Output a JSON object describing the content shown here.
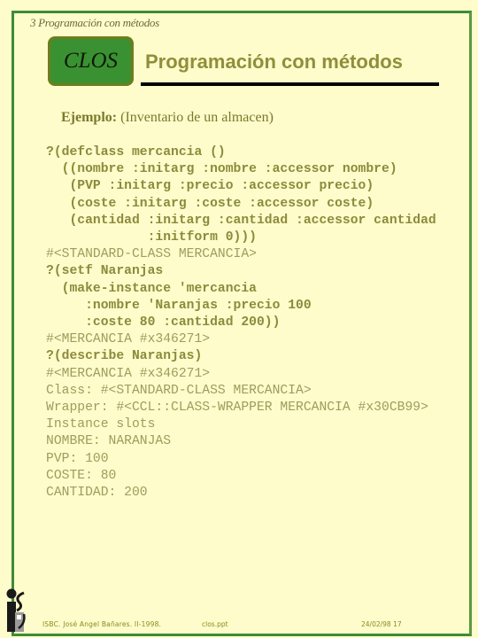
{
  "header": {
    "section_label": "3 Programación con métodos",
    "badge": "CLOS",
    "title": "Programación con métodos"
  },
  "example": {
    "label": "Ejemplo:",
    "description": "(Inventario de un almacen)"
  },
  "code_lines": [
    {
      "text": "?(defclass mercancia ()",
      "kind": "in"
    },
    {
      "text": "  ((nombre :initarg :nombre :accessor nombre)",
      "kind": "in"
    },
    {
      "text": "   (PVP :initarg :precio :accessor precio)",
      "kind": "in"
    },
    {
      "text": "   (coste :initarg :coste :accessor coste)",
      "kind": "in"
    },
    {
      "text": "   (cantidad :initarg :cantidad :accessor cantidad",
      "kind": "in"
    },
    {
      "text": "             :initform 0)))",
      "kind": "in"
    },
    {
      "text": "#<STANDARD-CLASS MERCANCIA>",
      "kind": "out"
    },
    {
      "text": "?(setf Naranjas",
      "kind": "in"
    },
    {
      "text": "  (make-instance 'mercancia",
      "kind": "in"
    },
    {
      "text": "     :nombre 'Naranjas :precio 100",
      "kind": "in"
    },
    {
      "text": "     :coste 80 :cantidad 200))",
      "kind": "in"
    },
    {
      "text": "#<MERCANCIA #x346271>",
      "kind": "out"
    },
    {
      "text": "?(describe Naranjas)",
      "kind": "in"
    },
    {
      "text": "#<MERCANCIA #x346271>",
      "kind": "out"
    },
    {
      "text": "Class: #<STANDARD-CLASS MERCANCIA>",
      "kind": "out"
    },
    {
      "text": "Wrapper: #<CCL::CLASS-WRAPPER MERCANCIA #x30CB99>",
      "kind": "out"
    },
    {
      "text": "Instance slots",
      "kind": "out"
    },
    {
      "text": "NOMBRE: NARANJAS",
      "kind": "out"
    },
    {
      "text": "PVP: 100",
      "kind": "out"
    },
    {
      "text": "COSTE: 80",
      "kind": "out"
    },
    {
      "text": "CANTIDAD: 200",
      "kind": "out"
    }
  ],
  "footer": {
    "author": "ISBC. José Angel Bañares. II-1998.",
    "file": "clos.ppt",
    "date_page": "24/02/98  17"
  },
  "logo": {
    "icon": "isbc-logo-icon"
  },
  "colors": {
    "background": "#fffccc",
    "frame": "#3e8c36",
    "badge": "#3a9132",
    "title": "#8f8f3a"
  }
}
